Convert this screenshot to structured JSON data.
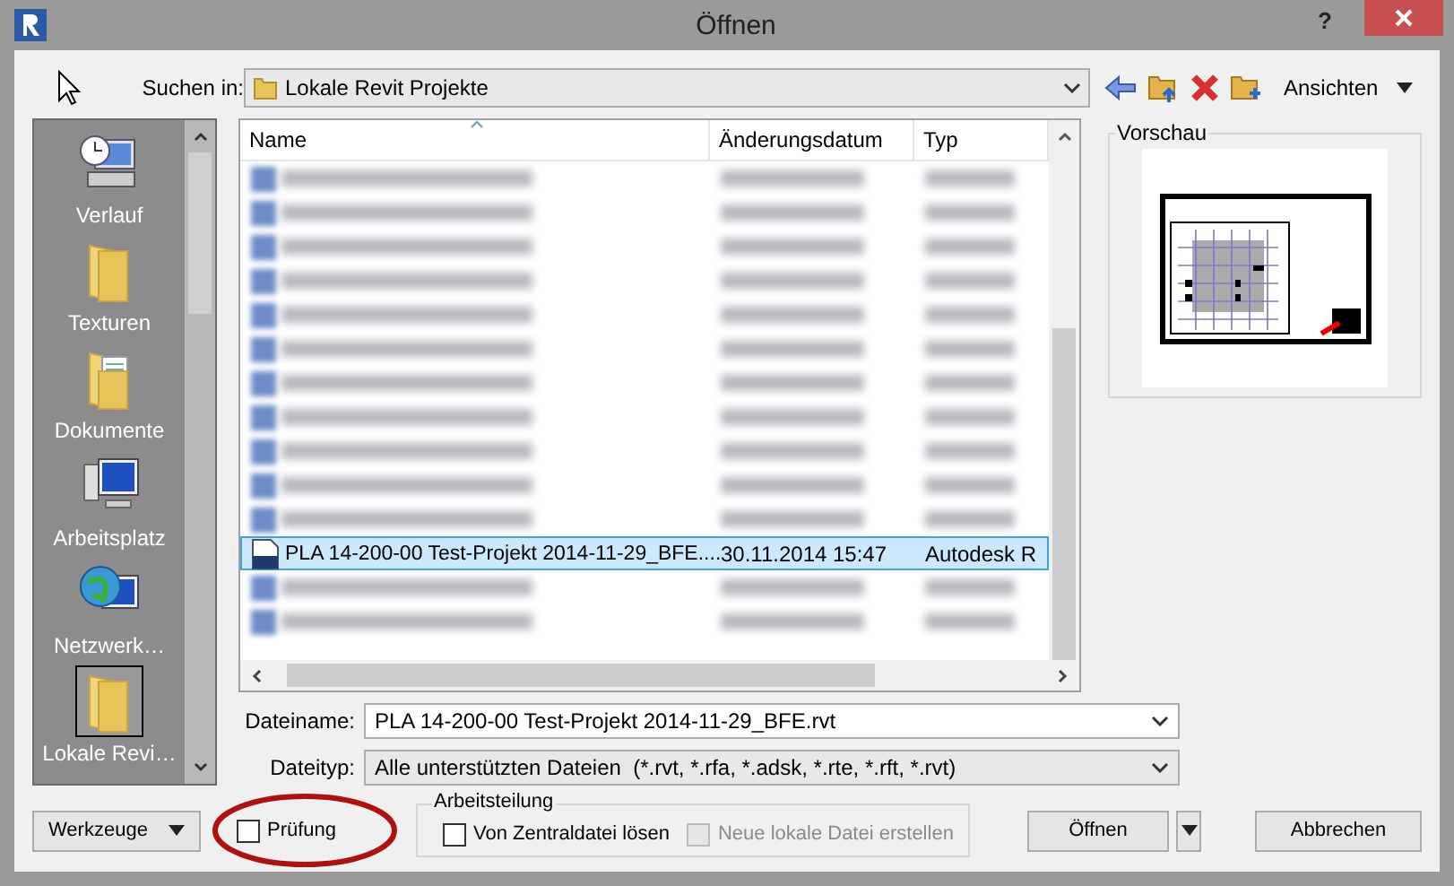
{
  "window": {
    "title": "Öffnen",
    "help": "?"
  },
  "lookin": {
    "label": "Suchen in:",
    "value": "Lokale Revit Projekte"
  },
  "views_button": {
    "label": "Ansichten"
  },
  "places": [
    {
      "label": "Verlauf",
      "kind": "history",
      "selected": false
    },
    {
      "label": "Texturen",
      "kind": "folder",
      "selected": false
    },
    {
      "label": "Dokumente",
      "kind": "documents",
      "selected": false
    },
    {
      "label": "Arbeitsplatz",
      "kind": "computer",
      "selected": false
    },
    {
      "label": "Netzwerk…",
      "kind": "network",
      "selected": false
    },
    {
      "label": "Lokale Revi…",
      "kind": "folder",
      "selected": true
    }
  ],
  "file_list": {
    "columns": [
      "Name",
      "Änderungsdatum",
      "Typ"
    ],
    "rows": [
      {
        "kind": "blurred",
        "selected": false
      },
      {
        "kind": "blurred",
        "selected": false
      },
      {
        "kind": "blurred",
        "selected": false
      },
      {
        "kind": "blurred",
        "selected": false
      },
      {
        "kind": "blurred",
        "selected": false
      },
      {
        "kind": "blurred",
        "selected": false
      },
      {
        "kind": "blurred",
        "selected": false
      },
      {
        "kind": "blurred",
        "selected": false
      },
      {
        "kind": "blurred",
        "selected": false
      },
      {
        "kind": "blurred",
        "selected": false
      },
      {
        "kind": "blurred",
        "selected": false
      },
      {
        "kind": "file",
        "name": "PLA 14-200-00 Test-Projekt 2014-11-29_BFE....",
        "date": "30.11.2014 15:47",
        "type": "Autodesk R",
        "selected": true
      },
      {
        "kind": "blurred",
        "selected": false
      },
      {
        "kind": "blurred",
        "selected": false
      }
    ]
  },
  "preview": {
    "label": "Vorschau"
  },
  "filename": {
    "label": "Dateiname:",
    "value": "PLA 14-200-00 Test-Projekt 2014-11-29_BFE.rvt"
  },
  "filetype": {
    "label": "Dateityp:",
    "value": "Alle unterstützten Dateien  (*.rvt, *.rfa, *.adsk, *.rte, *.rft, *.rvt)"
  },
  "tools_button": {
    "label": "Werkzeuge"
  },
  "audit": {
    "label": "Prüfung",
    "checked": false
  },
  "worksharing": {
    "title": "Arbeitsteilung",
    "options": [
      {
        "label": "Von Zentraldatei lösen",
        "checked": false,
        "disabled": false
      },
      {
        "label": "Neue lokale Datei erstellen",
        "checked": false,
        "disabled": true
      }
    ]
  },
  "buttons": [
    {
      "label": "Öffnen",
      "kind": "split"
    },
    {
      "label": "Abbrechen",
      "kind": "plain"
    }
  ]
}
